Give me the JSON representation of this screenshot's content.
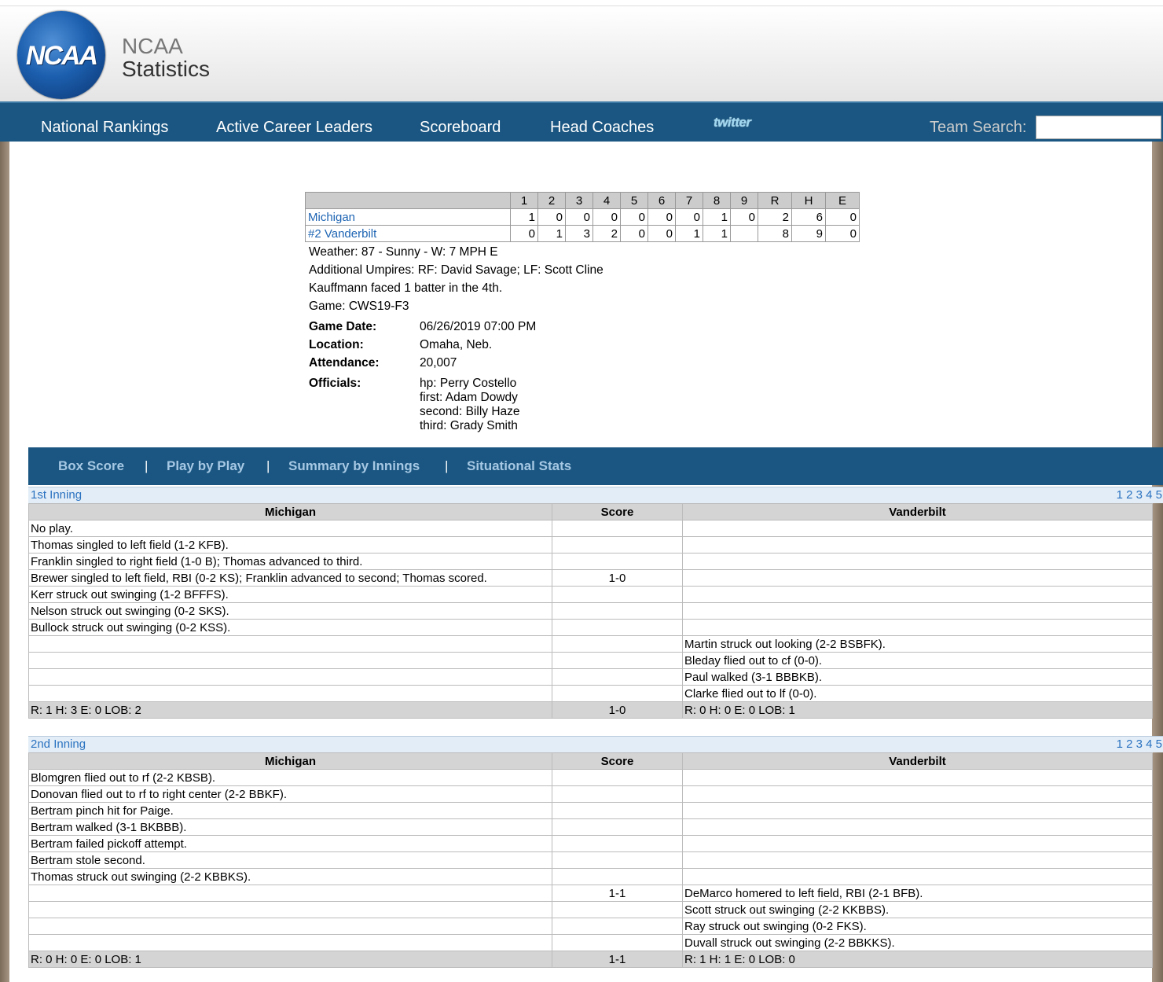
{
  "brand": {
    "logo_text": "NCAA",
    "line1": "NCAA",
    "line2": "Statistics"
  },
  "nav": {
    "items": [
      "National Rankings",
      "Active Career Leaders",
      "Scoreboard",
      "Head Coaches"
    ],
    "twitter": "twitter",
    "search_label": "Team Search:"
  },
  "linescore": {
    "headers": [
      "1",
      "2",
      "3",
      "4",
      "5",
      "6",
      "7",
      "8",
      "9",
      "R",
      "H",
      "E"
    ],
    "rows": [
      {
        "team": "Michigan",
        "cells": [
          "1",
          "0",
          "0",
          "0",
          "0",
          "0",
          "0",
          "1",
          "0",
          "2",
          "6",
          "0"
        ]
      },
      {
        "team": "#2 Vanderbilt",
        "cells": [
          "0",
          "1",
          "3",
          "2",
          "0",
          "0",
          "1",
          "1",
          "",
          "8",
          "9",
          "0"
        ]
      }
    ]
  },
  "notes": [
    "Weather: 87 - Sunny - W: 7 MPH E",
    "Additional Umpires: RF: David Savage; LF: Scott Cline",
    "Kauffmann faced 1 batter in the 4th.",
    "Game: CWS19-F3"
  ],
  "game_info": {
    "date_label": "Game Date:",
    "date": "06/26/2019 07:00 PM",
    "location_label": "Location:",
    "location": "Omaha, Neb.",
    "attendance_label": "Attendance:",
    "attendance": "20,007",
    "officials_label": "Officials:",
    "officials": [
      "hp: Perry Costello",
      "first: Adam Dowdy",
      "second: Billy Haze",
      "third: Grady Smith"
    ]
  },
  "tabs": {
    "items": [
      "Box Score",
      "Play by Play",
      "Summary by Innings",
      "Situational Stats"
    ],
    "separator": "|"
  },
  "innings": [
    {
      "title": "1st Inning",
      "pages": [
        "1",
        "2",
        "3",
        "4",
        "5"
      ],
      "headers": [
        "Michigan",
        "Score",
        "Vanderbilt"
      ],
      "rows": [
        [
          "No play.",
          "",
          ""
        ],
        [
          "Thomas singled to left field (1-2 KFB).",
          "",
          ""
        ],
        [
          "Franklin singled to right field (1-0 B); Thomas advanced to third.",
          "",
          ""
        ],
        [
          "Brewer singled to left field, RBI (0-2 KS); Franklin advanced to second; Thomas scored.",
          "1-0",
          ""
        ],
        [
          "Kerr struck out swinging (1-2 BFFFS).",
          "",
          ""
        ],
        [
          "Nelson struck out swinging (0-2 SKS).",
          "",
          ""
        ],
        [
          "Bullock struck out swinging (0-2 KSS).",
          "",
          ""
        ],
        [
          "",
          "",
          "Martin struck out looking (2-2 BSBFK)."
        ],
        [
          "",
          "",
          "Bleday flied out to cf (0-0)."
        ],
        [
          "",
          "",
          "Paul walked (3-1 BBBKB)."
        ],
        [
          "",
          "",
          "Clarke flied out to lf (0-0)."
        ]
      ],
      "totals": [
        "R: 1 H: 3 E: 0 LOB: 2",
        "1-0",
        "R: 0 H: 0 E: 0 LOB: 1"
      ]
    },
    {
      "title": "2nd Inning",
      "pages": [
        "1",
        "2",
        "3",
        "4",
        "5"
      ],
      "headers": [
        "Michigan",
        "Score",
        "Vanderbilt"
      ],
      "rows": [
        [
          "Blomgren flied out to rf (2-2 KBSB).",
          "",
          ""
        ],
        [
          "Donovan flied out to rf to right center (2-2 BBKF).",
          "",
          ""
        ],
        [
          "Bertram pinch hit for Paige.",
          "",
          ""
        ],
        [
          "Bertram walked (3-1 BKBBB).",
          "",
          ""
        ],
        [
          "Bertram failed pickoff attempt.",
          "",
          ""
        ],
        [
          "Bertram stole second.",
          "",
          ""
        ],
        [
          "Thomas struck out swinging (2-2 KBBKS).",
          "",
          ""
        ],
        [
          "",
          "1-1",
          "DeMarco homered to left field, RBI (2-1 BFB)."
        ],
        [
          "",
          "",
          "Scott struck out swinging (2-2 KKBBS)."
        ],
        [
          "",
          "",
          "Ray struck out swinging (0-2 FKS)."
        ],
        [
          "",
          "",
          "Duvall struck out swinging (2-2 BBKKS)."
        ]
      ],
      "totals": [
        "R: 0 H: 0 E: 0 LOB: 1",
        "1-1",
        "R: 1 H: 1 E: 0 LOB: 0"
      ]
    }
  ],
  "colors": {
    "nav_bg": "#1a5681",
    "link": "#2a72c0",
    "tab_link": "#a6c8e4",
    "header_cell": "#d4d4d4"
  }
}
